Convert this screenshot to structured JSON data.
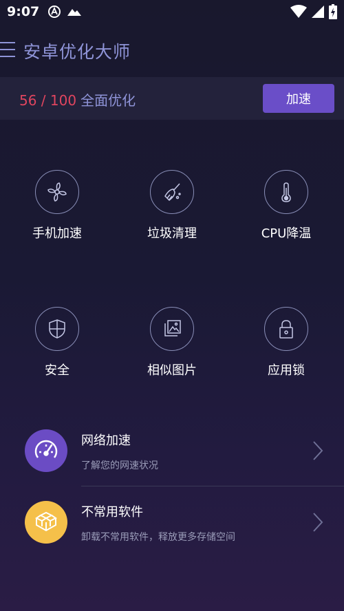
{
  "status_bar": {
    "time": "9:07",
    "left_icons": [
      "a-circle-icon",
      "mountain-icon"
    ],
    "right_icons": [
      "wifi-icon",
      "signal-icon",
      "battery-icon"
    ]
  },
  "app_bar": {
    "menu_icon": "hamburger-menu-icon",
    "title": "安卓优化大师"
  },
  "score": {
    "value": "56 / 100",
    "label": "全面优化",
    "button_label": "加速"
  },
  "features": [
    {
      "label": "手机加速",
      "icon": "fan-icon"
    },
    {
      "label": "垃圾清理",
      "icon": "broom-icon"
    },
    {
      "label": "CPU降温",
      "icon": "thermometer-icon"
    },
    {
      "label": "安全",
      "icon": "shield-icon"
    },
    {
      "label": "相似图片",
      "icon": "photos-icon"
    },
    {
      "label": "应用锁",
      "icon": "lock-icon"
    }
  ],
  "list": [
    {
      "title": "网络加速",
      "subtitle": "了解您的网速状况",
      "icon": "speedometer-icon",
      "icon_color": "#6b4cc4"
    },
    {
      "title": "不常用软件",
      "subtitle": "卸载不常用软件，释放更多存储空间",
      "icon": "boxes-icon",
      "icon_color": "#f5c04a"
    }
  ],
  "colors": {
    "accent": "#6a4ec8",
    "score_red": "#e0455f",
    "title_blue": "#8f94d8"
  }
}
